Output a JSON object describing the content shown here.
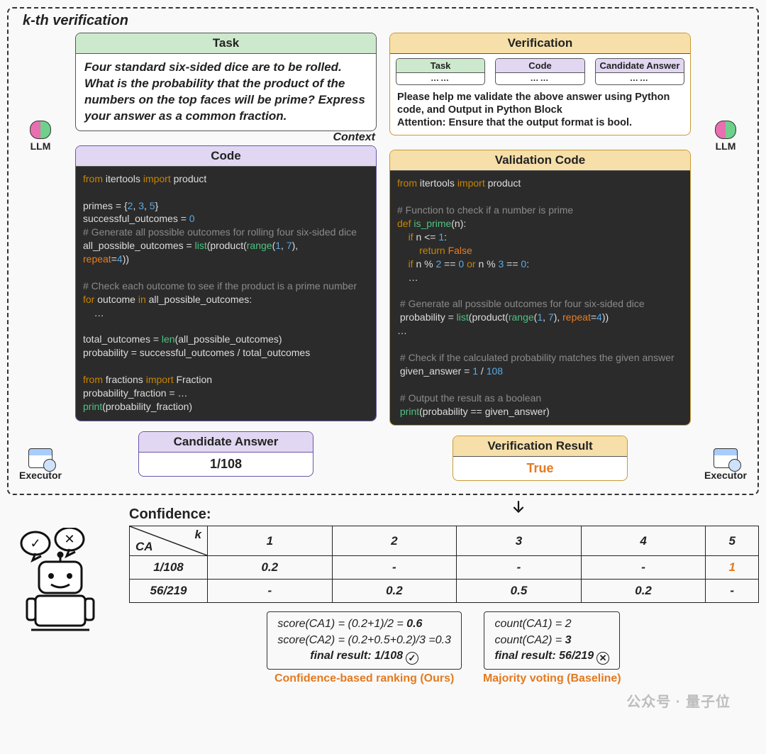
{
  "kbox_title": "k-th verification",
  "labels": {
    "task_head": "Task",
    "code_head": "Code",
    "verification_head": "Verification",
    "validation_code_head": "Validation Code",
    "candidate_head": "Candidate Answer",
    "verif_result_head": "Verification Result",
    "llm": "LLM",
    "executor": "Executor",
    "context": "Context",
    "mini_task": "Task",
    "mini_code": "Code",
    "mini_ca": "Candidate Answer",
    "mini_dots": "……",
    "confidence": "Confidence:",
    "ca_header": "CA",
    "k_header": "k",
    "ours": "Confidence-based ranking  (Ours)",
    "baseline": "Majority voting (Baseline)"
  },
  "task_body": "Four standard six-sided dice are to be rolled. What is the probability that the product of the numbers on the top faces will be prime? Express your answer as a common fraction.",
  "verification_prompt": "Please help me validate the above answer using Python code, and Output in Python Block\nAttention: Ensure that the output format is bool.",
  "candidate_value": "1/108",
  "verif_result_value": "True",
  "code_lines_left": [
    {
      "t": "kw",
      "s": "from "
    },
    {
      "t": "txt",
      "s": "itertools "
    },
    {
      "t": "kw",
      "s": "import "
    },
    {
      "t": "txt",
      "s": "product\n\n"
    },
    {
      "t": "txt",
      "s": "primes = {"
    },
    {
      "t": "num",
      "s": "2"
    },
    {
      "t": "txt",
      "s": ", "
    },
    {
      "t": "num",
      "s": "3"
    },
    {
      "t": "txt",
      "s": ", "
    },
    {
      "t": "num",
      "s": "5"
    },
    {
      "t": "txt",
      "s": "}\n"
    },
    {
      "t": "txt",
      "s": "successful_outcomes = "
    },
    {
      "t": "num",
      "s": "0"
    },
    {
      "t": "txt",
      "s": "\n"
    },
    {
      "t": "com",
      "s": "# Generate all possible outcomes for rolling four six-sided dice\n"
    },
    {
      "t": "txt",
      "s": "all_possible_outcomes = "
    },
    {
      "t": "fn",
      "s": "list"
    },
    {
      "t": "txt",
      "s": "(product("
    },
    {
      "t": "fn",
      "s": "range"
    },
    {
      "t": "txt",
      "s": "("
    },
    {
      "t": "num",
      "s": "1"
    },
    {
      "t": "txt",
      "s": ", "
    },
    {
      "t": "num",
      "s": "7"
    },
    {
      "t": "txt",
      "s": "),\n"
    },
    {
      "t": "rd",
      "s": "repeat"
    },
    {
      "t": "txt",
      "s": "="
    },
    {
      "t": "num",
      "s": "4"
    },
    {
      "t": "txt",
      "s": "))\n\n"
    },
    {
      "t": "com",
      "s": "# Check each outcome to see if the product is a prime number\n"
    },
    {
      "t": "kw",
      "s": "for "
    },
    {
      "t": "txt",
      "s": "outcome "
    },
    {
      "t": "kw",
      "s": "in "
    },
    {
      "t": "txt",
      "s": "all_possible_outcomes:\n    …\n\n"
    },
    {
      "t": "txt",
      "s": "total_outcomes = "
    },
    {
      "t": "fn",
      "s": "len"
    },
    {
      "t": "txt",
      "s": "(all_possible_outcomes)\n"
    },
    {
      "t": "txt",
      "s": "probability = successful_outcomes / total_outcomes\n\n"
    },
    {
      "t": "kw",
      "s": "from "
    },
    {
      "t": "txt",
      "s": "fractions "
    },
    {
      "t": "kw",
      "s": "import "
    },
    {
      "t": "txt",
      "s": "Fraction\n"
    },
    {
      "t": "txt",
      "s": "probability_fraction = …\n"
    },
    {
      "t": "fn",
      "s": "print"
    },
    {
      "t": "txt",
      "s": "(probability_fraction)"
    }
  ],
  "code_lines_right": [
    {
      "t": "kw",
      "s": "from "
    },
    {
      "t": "txt",
      "s": "itertools "
    },
    {
      "t": "kw",
      "s": "import "
    },
    {
      "t": "txt",
      "s": "product\n\n"
    },
    {
      "t": "com",
      "s": "# Function to check if a number is prime\n"
    },
    {
      "t": "kw",
      "s": "def "
    },
    {
      "t": "fn",
      "s": "is_prime"
    },
    {
      "t": "txt",
      "s": "(n):\n    "
    },
    {
      "t": "kw",
      "s": "if "
    },
    {
      "t": "txt",
      "s": "n <= "
    },
    {
      "t": "num",
      "s": "1"
    },
    {
      "t": "txt",
      "s": ":\n        "
    },
    {
      "t": "kw",
      "s": "return "
    },
    {
      "t": "rd",
      "s": "False"
    },
    {
      "t": "txt",
      "s": "\n    "
    },
    {
      "t": "kw",
      "s": "if "
    },
    {
      "t": "txt",
      "s": "n % "
    },
    {
      "t": "num",
      "s": "2"
    },
    {
      "t": "txt",
      "s": " == "
    },
    {
      "t": "num",
      "s": "0"
    },
    {
      "t": "kw",
      "s": " or "
    },
    {
      "t": "txt",
      "s": "n % "
    },
    {
      "t": "num",
      "s": "3"
    },
    {
      "t": "txt",
      "s": " == "
    },
    {
      "t": "num",
      "s": "0"
    },
    {
      "t": "txt",
      "s": ":\n    …\n\n"
    },
    {
      "t": "com",
      "s": " # Generate all possible outcomes for four six-sided dice\n"
    },
    {
      "t": "txt",
      "s": " probability = "
    },
    {
      "t": "fn",
      "s": "list"
    },
    {
      "t": "txt",
      "s": "(product("
    },
    {
      "t": "fn",
      "s": "range"
    },
    {
      "t": "txt",
      "s": "("
    },
    {
      "t": "num",
      "s": "1"
    },
    {
      "t": "txt",
      "s": ", "
    },
    {
      "t": "num",
      "s": "7"
    },
    {
      "t": "txt",
      "s": "), "
    },
    {
      "t": "rd",
      "s": "repeat"
    },
    {
      "t": "txt",
      "s": "="
    },
    {
      "t": "num",
      "s": "4"
    },
    {
      "t": "txt",
      "s": "))\n…\n\n"
    },
    {
      "t": "com",
      "s": " # Check if the calculated probability matches the given answer\n"
    },
    {
      "t": "txt",
      "s": " given_answer = "
    },
    {
      "t": "num",
      "s": "1"
    },
    {
      "t": "txt",
      "s": " / "
    },
    {
      "t": "num",
      "s": "108"
    },
    {
      "t": "txt",
      "s": "\n\n"
    },
    {
      "t": "com",
      "s": " # Output the result as a boolean\n"
    },
    {
      "t": "fn",
      "s": " print"
    },
    {
      "t": "txt",
      "s": "(probability == given_answer)"
    }
  ],
  "confidence_table": {
    "k_headers": [
      "1",
      "2",
      "3",
      "4",
      "5"
    ],
    "rows": [
      {
        "ca": "1/108",
        "cells": [
          "0.2",
          "-",
          "-",
          "-",
          "1"
        ],
        "hl": 4
      },
      {
        "ca": "56/219",
        "cells": [
          "-",
          "0.2",
          "0.5",
          "0.2",
          "-"
        ],
        "hl": -1
      }
    ]
  },
  "score_ours": {
    "line1": "score(CA1) = (0.2+1)/2 = 0.6",
    "line2": "score(CA2) = (0.2+0.5+0.2)/3 =0.3",
    "final": "final result:  1/108"
  },
  "score_base": {
    "line1": "count(CA1) = 2",
    "line2": "count(CA2) = 3",
    "final": "final result:  56/219"
  },
  "watermark": "公众号 · 量子位"
}
